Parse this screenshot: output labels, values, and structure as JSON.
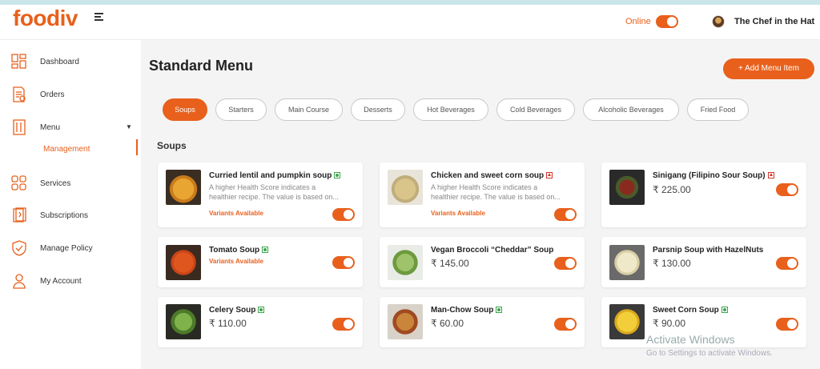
{
  "app": {
    "logo": "foodiv"
  },
  "header": {
    "online_label": "Online",
    "user_name": "The Chef in the Hat"
  },
  "sidebar": {
    "items": [
      {
        "label": "Dashboard"
      },
      {
        "label": "Orders"
      },
      {
        "label": "Menu"
      },
      {
        "label": "Services"
      },
      {
        "label": "Subscriptions"
      },
      {
        "label": "Manage Policy"
      },
      {
        "label": "My Account"
      }
    ],
    "submenu": {
      "label": "Management"
    }
  },
  "main": {
    "title": "Standard Menu",
    "add_button": "+ Add Menu Item",
    "tabs": [
      {
        "label": "Soups"
      },
      {
        "label": "Starters"
      },
      {
        "label": "Main Course"
      },
      {
        "label": "Desserts"
      },
      {
        "label": "Hot Beverages"
      },
      {
        "label": "Cold Beverages"
      },
      {
        "label": "Alcoholic Beverages"
      },
      {
        "label": "Fried Food"
      }
    ],
    "section_title": "Soups",
    "items": [
      {
        "name": "Curried lentil and pumpkin soup",
        "type": "veg",
        "desc_1": "A higher Health Score indicates a",
        "desc_2": "healthier recipe. The value is based on...",
        "variants": "Variants Available",
        "enabled": true
      },
      {
        "name": "Chicken and sweet corn soup",
        "type": "non-veg",
        "desc_1": "A higher Health Score indicates a",
        "desc_2": "healthier recipe. The value is based on...",
        "variants": "Variants Available",
        "enabled": true
      },
      {
        "name": "Sinigang (Filipino Sour Soup)",
        "type": "non-veg",
        "price": "₹ 225.00",
        "enabled": true
      },
      {
        "name": "Tomato Soup",
        "type": "veg",
        "variants": "Variants Available",
        "enabled": true
      },
      {
        "name": "Vegan Broccoli “Cheddar” Soup",
        "price": "₹ 145.00",
        "enabled": true
      },
      {
        "name": "Parsnip Soup with HazelNuts",
        "price": "₹ 130.00",
        "enabled": true
      },
      {
        "name": "Celery Soup",
        "type": "veg",
        "price": "₹ 110.00",
        "enabled": true
      },
      {
        "name": "Man-Chow Soup",
        "type": "veg",
        "price": "₹ 60.00",
        "enabled": true
      },
      {
        "name": "Sweet Corn Soup",
        "type": "veg",
        "price": "₹ 90.00",
        "enabled": true
      }
    ]
  },
  "watermark": {
    "line1": "Activate Windows",
    "line2": "Go to Settings to activate Windows."
  },
  "colors": {
    "accent": "#e8601c",
    "veg": "#3aa64a",
    "non_veg": "#d0342c"
  },
  "icons": [
    "menu-icon",
    "dashboard-icon",
    "orders-icon",
    "menu-book-icon",
    "services-icon",
    "subscriptions-icon",
    "policy-shield-icon",
    "account-icon",
    "veg-mark-icon",
    "non-veg-mark-icon"
  ]
}
